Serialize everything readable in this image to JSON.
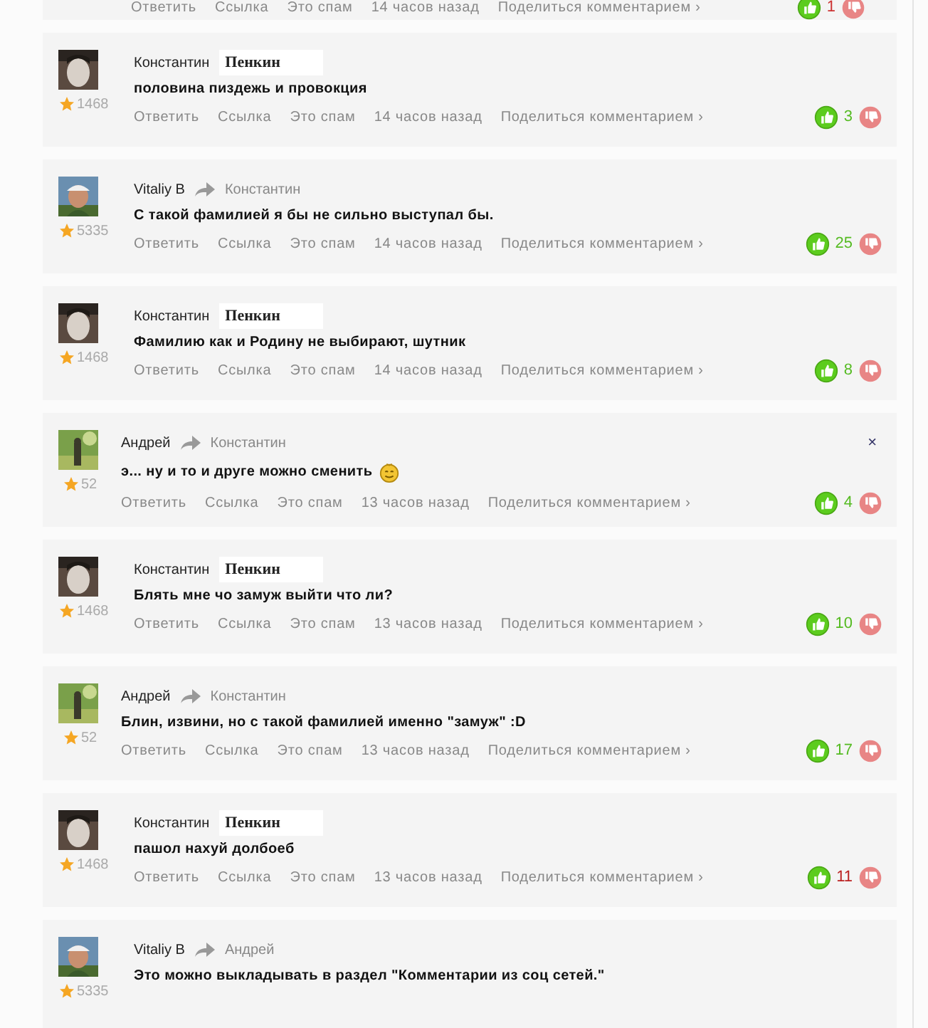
{
  "top_actions": {
    "actions": [
      "Ответить",
      "Ссылка",
      "Это спам",
      "14 часов назад",
      "Поделиться комментарием ›"
    ],
    "likes": "1",
    "color": "#cc3333"
  },
  "comments": [
    {
      "kind": "root",
      "author": "Константин",
      "surname": "Пенкин",
      "rating": "1468",
      "text": "половина пиздежь и провокция",
      "actions": [
        "Ответить",
        "Ссылка",
        "Это спам",
        "14 часов назад",
        "Поделиться комментарием ›"
      ],
      "likes": "3",
      "color": "#55bb22"
    },
    {
      "kind": "root",
      "author": "Vitaliy B",
      "reply_to": "Константин",
      "rating": "5335",
      "text": "С такой фамилией я бы не сильно выступал бы.",
      "actions": [
        "Ответить",
        "Ссылка",
        "Это спам",
        "14 часов назад",
        "Поделиться комментарием ›"
      ],
      "likes": "25",
      "color": "#55bb22"
    },
    {
      "kind": "root",
      "author": "Константин",
      "surname": "Пенкин",
      "rating": "1468",
      "text": "Фамилию как и Родину не выбирают, шутник",
      "actions": [
        "Ответить",
        "Ссылка",
        "Это спам",
        "14 часов назад",
        "Поделиться комментарием ›"
      ],
      "likes": "8",
      "color": "#55bb22"
    },
    {
      "kind": "nested",
      "author": "Андрей",
      "reply_to": "Константин",
      "rating": "52",
      "text": "э... ну и то и друге можно сменить",
      "emoji": true,
      "close": "×",
      "actions": [
        "Ответить",
        "Ссылка",
        "Это спам",
        "13 часов назад",
        "Поделиться комментарием ›"
      ],
      "likes": "4",
      "color": "#55bb22"
    },
    {
      "kind": "root",
      "author": "Константин",
      "surname": "Пенкин",
      "rating": "1468",
      "text": "Блять мне чо замуж выйти что ли?",
      "actions": [
        "Ответить",
        "Ссылка",
        "Это спам",
        "13 часов назад",
        "Поделиться комментарием ›"
      ],
      "likes": "10",
      "color": "#55bb22"
    },
    {
      "kind": "nested",
      "author": "Андрей",
      "reply_to": "Константин",
      "rating": "52",
      "text": "Блин, извини, но с такой фамилией именно \"замуж\" :D",
      "actions": [
        "Ответить",
        "Ссылка",
        "Это спам",
        "13 часов назад",
        "Поделиться комментарием ›"
      ],
      "likes": "17",
      "color": "#55bb22"
    },
    {
      "kind": "root",
      "author": "Константин",
      "surname": "Пенкин",
      "rating": "1468",
      "text": "пашол нахуй долбоеб",
      "actions": [
        "Ответить",
        "Ссылка",
        "Это спам",
        "13 часов назад",
        "Поделиться комментарием ›"
      ],
      "likes": "11",
      "color": "#bb2222"
    },
    {
      "kind": "root",
      "author": "Vitaliy B",
      "reply_to": "Андрей",
      "rating": "5335",
      "text": "Это можно выкладывать в раздел \"Комментарии из соц сетей.\""
    }
  ]
}
